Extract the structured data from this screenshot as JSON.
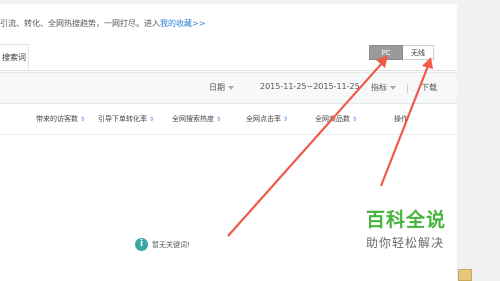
{
  "description": {
    "text": "引流、转化、全网热搜趋势，一网打尽。进入",
    "link": "我的收藏>>"
  },
  "tab": {
    "label": "搜索词"
  },
  "device_toggle": {
    "pc": "PC",
    "wireless": "无线",
    "selected": "PC"
  },
  "filter_bar": {
    "date_label": "日期",
    "date_range": "2015-11-25~2015-11-25",
    "metric_label": "指标",
    "download_label": "下载"
  },
  "columns": [
    {
      "label": "带来的访客数"
    },
    {
      "label": "引导下单转化率"
    },
    {
      "label": "全网搜索热度"
    },
    {
      "label": "全网点击率"
    },
    {
      "label": "全网商品数"
    },
    {
      "label": "操作"
    }
  ],
  "empty_state": {
    "message": "暂无关键词!"
  },
  "watermark": {
    "title": "百科全说",
    "subtitle": "助你轻松解决"
  },
  "colors": {
    "link": "#2a7fd4",
    "arrow": "#f05a4a",
    "watermark": "#46b43c",
    "toggle_active": "#9a9a9a"
  }
}
